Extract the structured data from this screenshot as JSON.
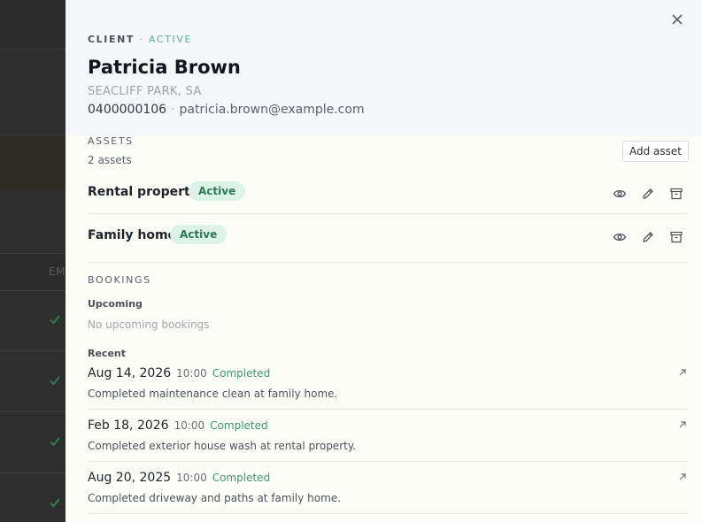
{
  "background_table": {
    "column_label": "EM"
  },
  "drawer": {
    "eyebrow_type": "CLIENT",
    "eyebrow_dot": "·",
    "eyebrow_status": "ACTIVE",
    "client_name": "Patricia Brown",
    "location": "SEACLIFF PARK, SA",
    "phone": "0400000106",
    "contact_sep": "·",
    "email": "patricia.brown@example.com"
  },
  "assets": {
    "title": "ASSETS",
    "count": "2 assets",
    "add_label": "Add asset",
    "items": [
      {
        "name": "Rental property",
        "status": "Active"
      },
      {
        "name": "Family home",
        "status": "Active"
      }
    ]
  },
  "bookings": {
    "title": "BOOKINGS",
    "upcoming_label": "Upcoming",
    "upcoming_empty": "No upcoming bookings",
    "recent_label": "Recent",
    "recent": [
      {
        "date": "Aug 14, 2026",
        "time": "10:00",
        "status": "Completed",
        "desc": "Completed maintenance clean at family home."
      },
      {
        "date": "Feb 18, 2026",
        "time": "10:00",
        "status": "Completed",
        "desc": "Completed exterior house wash at rental property."
      },
      {
        "date": "Aug 20, 2025",
        "time": "10:00",
        "status": "Completed",
        "desc": "Completed driveway and paths at family home."
      }
    ]
  },
  "icons": {
    "close": "close-icon",
    "view": "eye-icon",
    "edit": "pencil-icon",
    "archive": "archive-icon",
    "open_booking": "arrow-up-right-icon",
    "row_check": "check-icon"
  },
  "colors": {
    "overlay": "#2e2e2e",
    "drawer_bg": "#fdfdf7",
    "header_bg": "#f5f6f8",
    "active_pill_bg": "#ddf3e7",
    "active_pill_text": "#2d7a55",
    "completed_text": "#3d9a70",
    "check_green": "#2f7d4e"
  }
}
